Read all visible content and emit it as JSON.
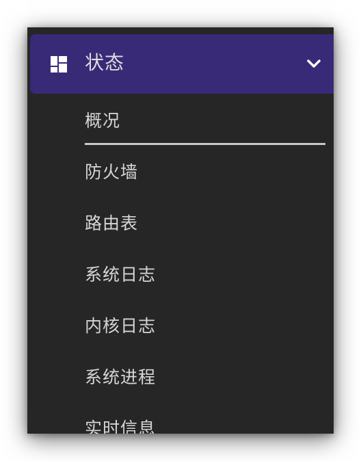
{
  "menu": {
    "header": {
      "label": "状态",
      "icon": "dashboard-icon",
      "expand_icon": "chevron-down-icon"
    },
    "items": [
      {
        "label": "概况",
        "active": true
      },
      {
        "label": "防火墙",
        "active": false
      },
      {
        "label": "路由表",
        "active": false
      },
      {
        "label": "系统日志",
        "active": false
      },
      {
        "label": "内核日志",
        "active": false
      },
      {
        "label": "系统进程",
        "active": false
      },
      {
        "label": "实时信息",
        "active": false
      }
    ]
  },
  "colors": {
    "panel_background": "#262626",
    "header_background": "#382a77",
    "text": "#d6d6d6",
    "active_underline": "#c8c8c8"
  }
}
